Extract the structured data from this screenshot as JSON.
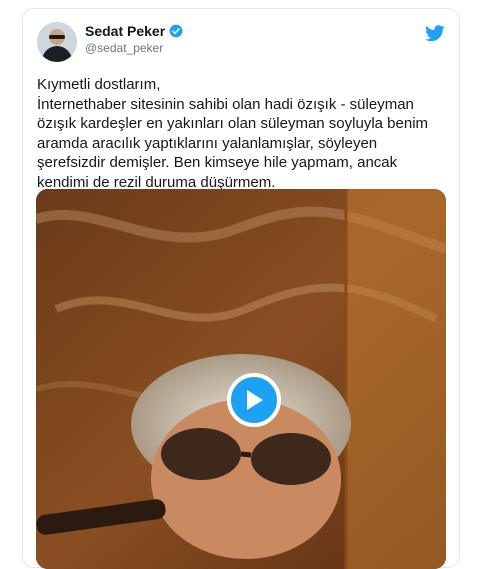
{
  "tweet": {
    "author_name": "Sedat Peker",
    "handle": "@sedat_peker",
    "text_lines": [
      "Kıymetli dostlarım,",
      "İnternethaber sitesinin sahibi olan hadi özışık - süleyman özışık kardeşler en yakınları olan süleyman soyluyla benim aramda aracılık yaptıklarını yalanlamışlar, söyleyen şerefsizdir demişler. Ben kimseye hile yapmam, ancak kendimi de rezil duruma düşürmem."
    ],
    "verified": true
  },
  "icons": {
    "verified": "verified-badge-icon",
    "logo": "twitter-bird-icon",
    "play": "play-icon"
  },
  "colors": {
    "accent": "#1da1f2",
    "text": "#14171a",
    "secondary_text": "#657786",
    "border": "#e1e8ed"
  }
}
